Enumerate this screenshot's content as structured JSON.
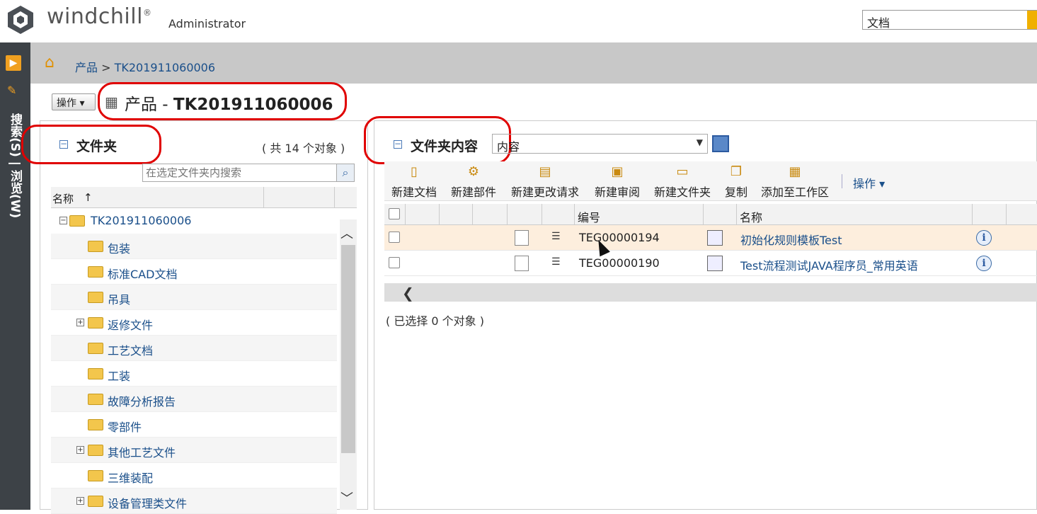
{
  "header": {
    "logo": "windchill",
    "role": "Administrator",
    "search_type": "文档"
  },
  "rail": {
    "tab_label": "搜索(S) | 浏览(W)"
  },
  "breadcrumb": {
    "root": "产品",
    "separator": ">",
    "current": "TK201911060006"
  },
  "title": {
    "actions": "操作",
    "prefix": "产品 - ",
    "name": "TK201911060006"
  },
  "folders": {
    "title": "文件夹",
    "count": "( 共 14 个对象 )",
    "search_placeholder": "在选定文件夹内搜索",
    "column": "名称",
    "sort_mark": "↑",
    "root": "TK201911060006",
    "items": [
      {
        "label": "包装",
        "expandable": false
      },
      {
        "label": "标准CAD文档",
        "expandable": false
      },
      {
        "label": "吊具",
        "expandable": false
      },
      {
        "label": "返修文件",
        "expandable": true
      },
      {
        "label": "工艺文档",
        "expandable": false
      },
      {
        "label": "工装",
        "expandable": false
      },
      {
        "label": "故障分析报告",
        "expandable": false
      },
      {
        "label": "零部件",
        "expandable": false
      },
      {
        "label": "其他工艺文件",
        "expandable": true
      },
      {
        "label": "三维装配",
        "expandable": false
      },
      {
        "label": "设备管理类文件",
        "expandable": true
      }
    ]
  },
  "contents": {
    "title": "文件夹内容",
    "view": "内容",
    "toolbar": [
      {
        "label": "新建文档"
      },
      {
        "label": "新建部件"
      },
      {
        "label": "新建更改请求"
      },
      {
        "label": "新建审阅"
      },
      {
        "label": "新建文件夹"
      },
      {
        "label": "复制"
      },
      {
        "label": "添加至工作区"
      }
    ],
    "actions": "操作 ▾",
    "columns": {
      "number": "编号",
      "name": "名称"
    },
    "rows": [
      {
        "number": "TEG00000194",
        "name": "初始化规则模板Test",
        "selected": true
      },
      {
        "number": "TEG00000190",
        "name": "Test流程测试JAVA程序员_常用英语",
        "selected": false
      }
    ],
    "status": "( 已选择 0 个对象 )"
  },
  "colors": {
    "rail": "#3d4247",
    "link": "#1a4f8a",
    "annotation": "#e00000",
    "folder": "#f3c64c"
  }
}
